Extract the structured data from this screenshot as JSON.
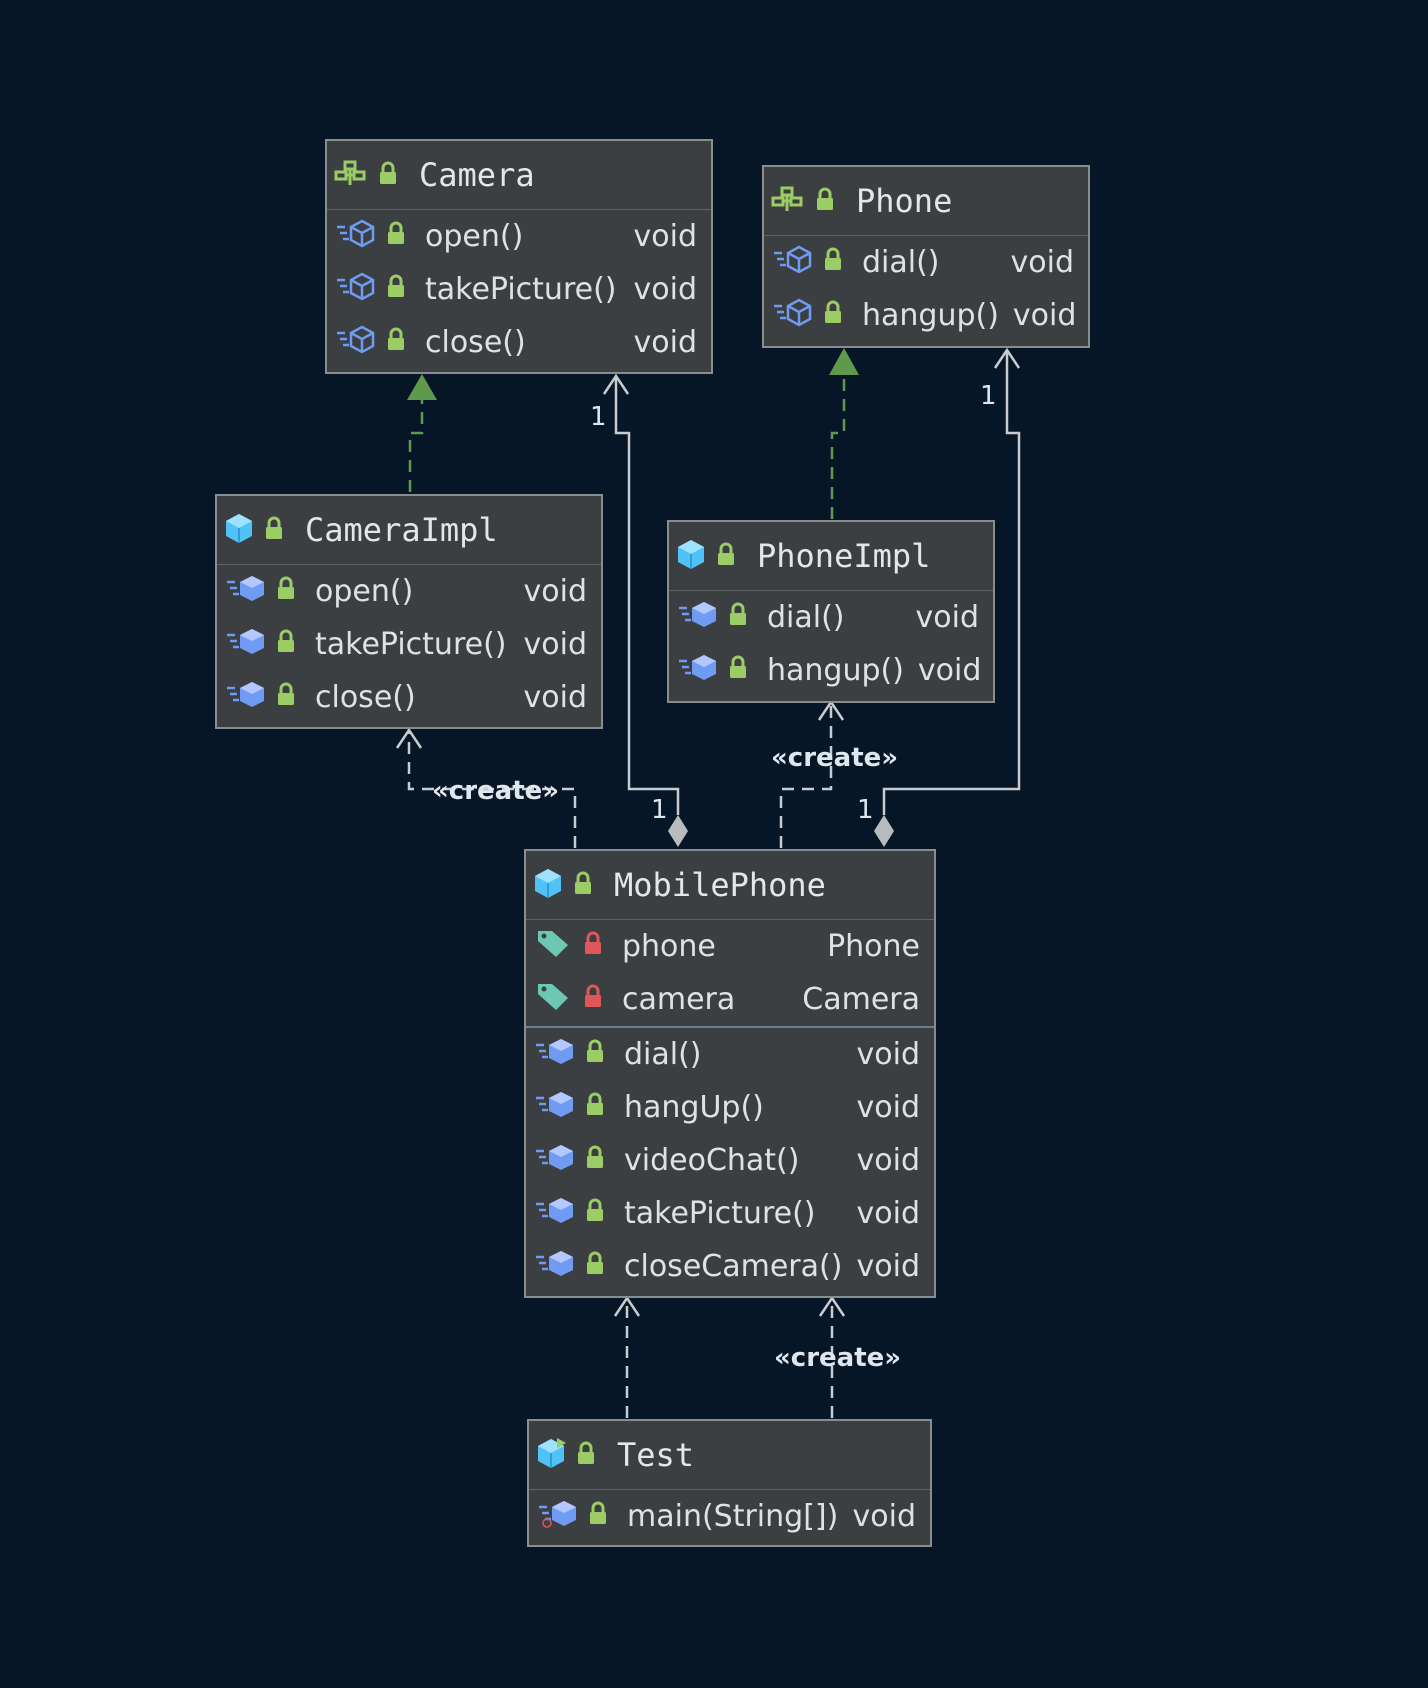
{
  "colors": {
    "background": "#071626",
    "node_fill": "#3c3f41",
    "node_border": "#8a8d90",
    "realization_edge": "#5f9a4c",
    "dependency_edge": "#c8ccd0",
    "lock_public": "#9ccc65",
    "lock_private": "#e05757",
    "class_icon": "#4fc3f7",
    "method_icon": "#6f9cf2",
    "field_icon": "#6cc7b3"
  },
  "nodes": {
    "camera": {
      "title": "Camera",
      "kind": "interface-icon",
      "methods": [
        {
          "name": "open()",
          "type": "void"
        },
        {
          "name": "takePicture()",
          "type": "void"
        },
        {
          "name": "close()",
          "type": "void"
        }
      ]
    },
    "phone": {
      "title": "Phone",
      "kind": "interface-icon",
      "methods": [
        {
          "name": "dial()",
          "type": "void"
        },
        {
          "name": "hangup()",
          "type": "void"
        }
      ]
    },
    "camera_impl": {
      "title": "CameraImpl",
      "kind": "class-icon",
      "methods": [
        {
          "name": "open()",
          "type": "void"
        },
        {
          "name": "takePicture()",
          "type": "void"
        },
        {
          "name": "close()",
          "type": "void"
        }
      ]
    },
    "phone_impl": {
      "title": "PhoneImpl",
      "kind": "class-icon",
      "methods": [
        {
          "name": "dial()",
          "type": "void"
        },
        {
          "name": "hangup()",
          "type": "void"
        }
      ]
    },
    "mobile_phone": {
      "title": "MobilePhone",
      "kind": "class-icon",
      "fields": [
        {
          "name": "phone",
          "type": "Phone"
        },
        {
          "name": "camera",
          "type": "Camera"
        }
      ],
      "methods": [
        {
          "name": "dial()",
          "type": "void"
        },
        {
          "name": "hangUp()",
          "type": "void"
        },
        {
          "name": "videoChat()",
          "type": "void"
        },
        {
          "name": "takePicture()",
          "type": "void"
        },
        {
          "name": "closeCamera()",
          "type": "void"
        }
      ]
    },
    "test": {
      "title": "Test",
      "kind": "runnable-class-icon",
      "methods": [
        {
          "name": "main(String[])",
          "type": "void"
        }
      ]
    }
  },
  "edges": {
    "camera_multiplicity": "1",
    "phone_multiplicity": "1",
    "mobile_camera_multiplicity": "1",
    "mobile_phone_multiplicity": "1",
    "create_camera_impl": "«create»",
    "create_phone_impl": "«create»",
    "create_mobile_phone": "«create»"
  }
}
